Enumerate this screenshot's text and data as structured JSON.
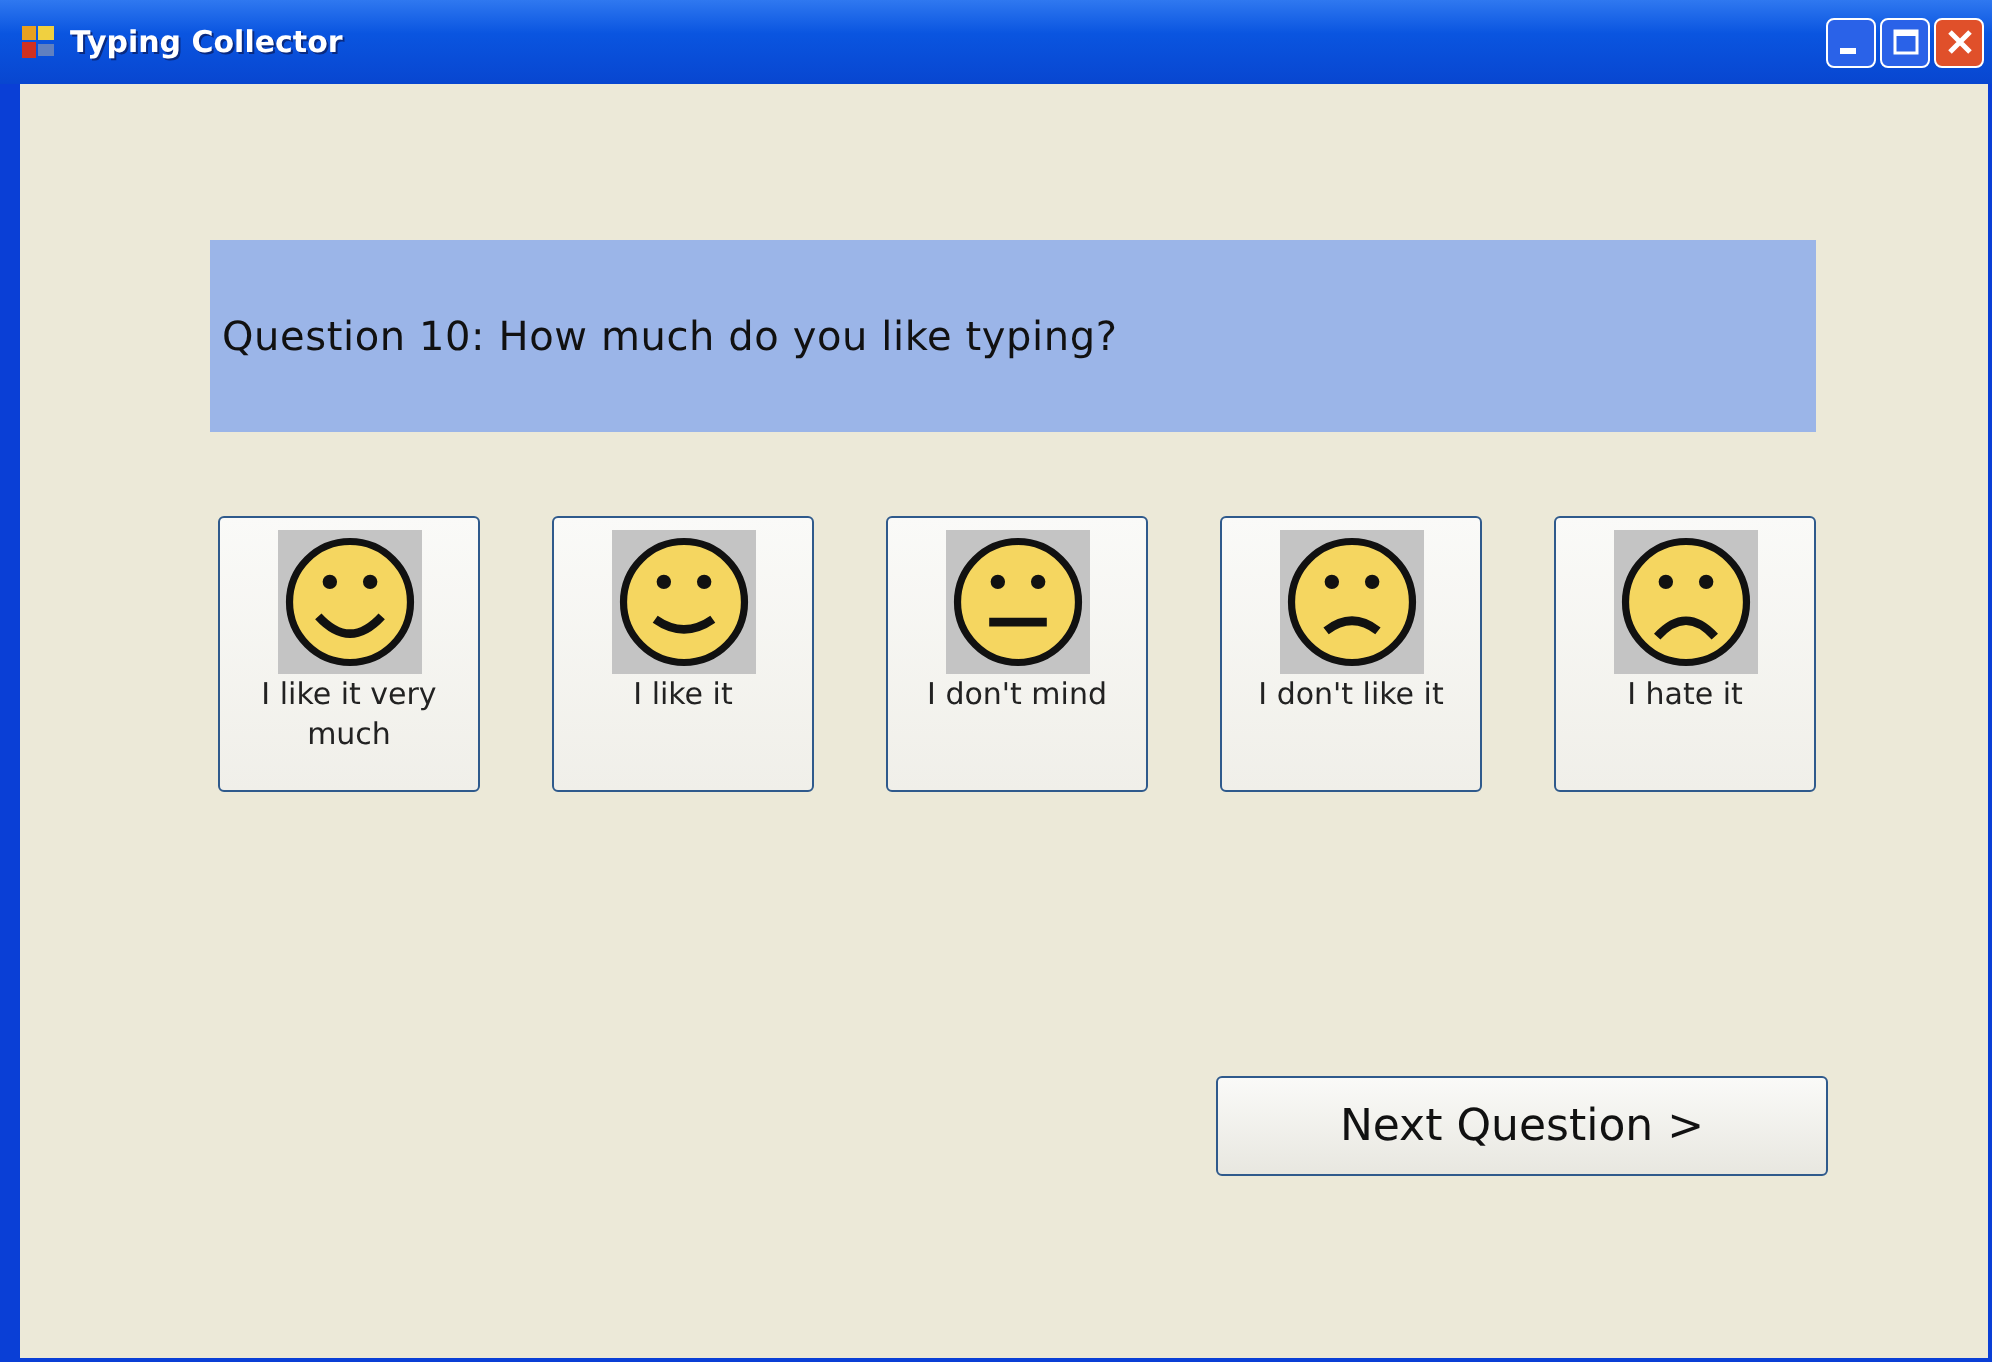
{
  "window": {
    "title": "Typing Collector"
  },
  "question": "Question 10: How much do you like typing?",
  "options": [
    {
      "label": "I like it very much",
      "kind": "grin"
    },
    {
      "label": "I like it",
      "kind": "smile"
    },
    {
      "label": "I don't mind",
      "kind": "neutral"
    },
    {
      "label": "I don't like it",
      "kind": "frown"
    },
    {
      "label": "I hate it",
      "kind": "sad"
    }
  ],
  "next_button": "Next Question >"
}
